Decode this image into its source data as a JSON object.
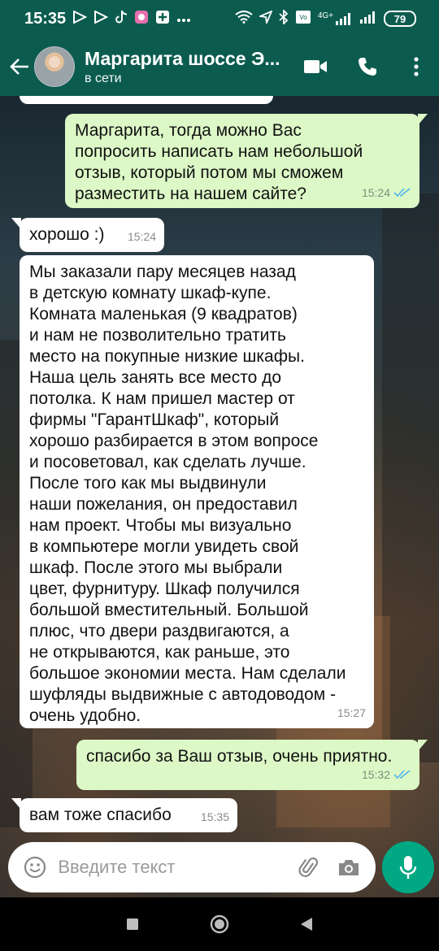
{
  "status_bar": {
    "time": "15:35",
    "app_icons": [
      "play-icon",
      "play-icon",
      "tiktok-icon",
      "gallery-icon",
      "plus-icon",
      "more-dots"
    ],
    "network": "4G+",
    "battery": "79"
  },
  "header": {
    "contact_name": "Маргарита шоссе Э...",
    "status": "в сети"
  },
  "messages": [
    {
      "direction": "out",
      "text": "Маргарита, тогда можно Вас\nпопросить написать нам небольшой\nотзыв, который потом мы сможем\nразместить на нашем сайте?",
      "time": "15:24",
      "read": true
    },
    {
      "direction": "in",
      "text": "хорошо :)",
      "time": "15:24"
    },
    {
      "direction": "in",
      "text": "Мы заказали пару месяцев назад\nв детскую комнату шкаф-купе.\nКомната маленькая (9 квадратов)\nи нам не позволительно тратить\nместо на покупные низкие шкафы.\nНаша цель занять все место до\nпотолка. К нам пришел мастер от\nфирмы \"ГарантШкаф\", который\nхорошо разбирается в этом вопросе\nи посоветовал, как сделать лучше.\nПосле того как мы выдвинули\nнаши пожелания, он предоставил\nнам проект. Чтобы мы визуально\nв компьютере могли увидеть свой\nшкаф. После этого мы выбрали\nцвет, фурнитуру. Шкаф получился\nбольшой вместительный. Большой\nплюс, что двери раздвигаются, а\nне открываются, как раньше, это\nбольшое экономии места. Нам сделали\nшуфляды выдвижные с автодоводом -\nочень удобно.",
      "time": "15:27"
    },
    {
      "direction": "out",
      "text": "спасибо за Ваш отзыв, очень приятно.",
      "time": "15:32",
      "read": true
    },
    {
      "direction": "in",
      "text": "вам тоже спасибо",
      "time": "15:35"
    }
  ],
  "composer": {
    "placeholder": "Введите текст"
  },
  "colors": {
    "header": "#0b5c4f",
    "outgoing_bubble": "#dcf8c6",
    "incoming_bubble": "#ffffff",
    "read_ticks": "#4fb6ec",
    "mic_button": "#00a884"
  }
}
